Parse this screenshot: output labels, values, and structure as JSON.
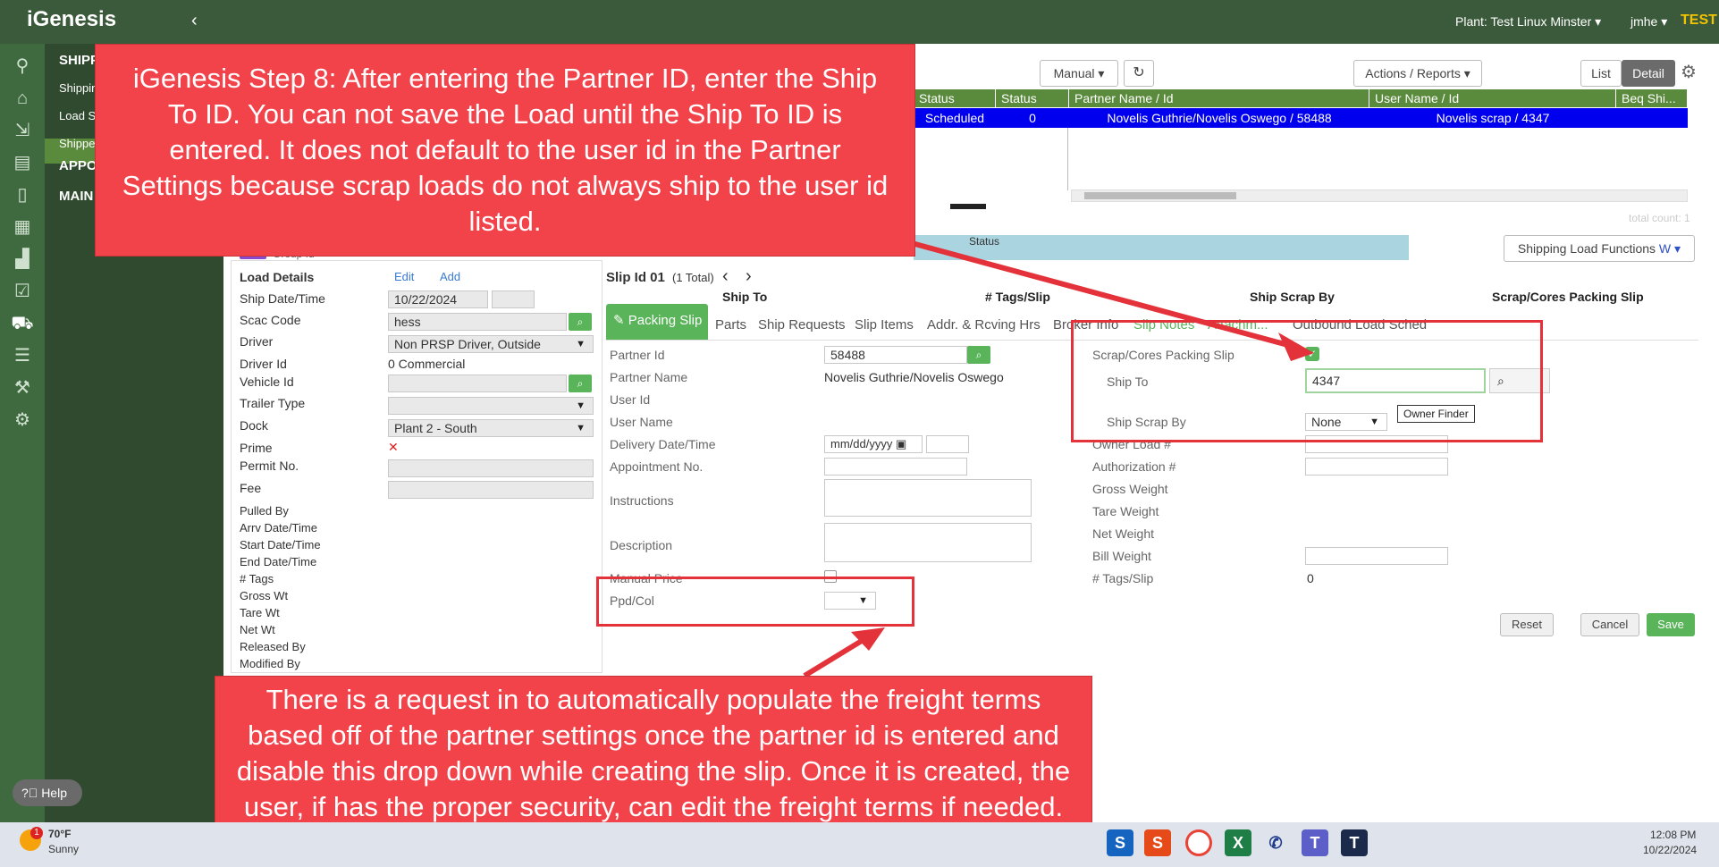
{
  "topbar": {
    "logo": "iGenesis",
    "plant": "Plant: Test Linux Minster",
    "user": "jmhe",
    "env": "TEST"
  },
  "sidebar": {
    "shipping_section": "SHIPP",
    "item1": "Shippin",
    "item2": "Load S",
    "item3": "Shippe",
    "appo_section": "APPO",
    "main_section": "MAIN",
    "help": "Help"
  },
  "toolbar": {
    "mode": "Manual",
    "actions": "Actions / Reports",
    "list": "List",
    "detail": "Detail"
  },
  "grid": {
    "headers": [
      "Status",
      "Status Code",
      "Partner Name / Id",
      "User Name / Id",
      "Beq Shi..."
    ],
    "row": {
      "status": "Scheduled",
      "status_code": "0",
      "partner": "Novelis Guthrie/Novelis Oswego / 58488",
      "user": "Novelis scrap / 4347"
    },
    "total_count": "total count: 1",
    "status_bar_label": "Status"
  },
  "shipping_functions": "Shipping Load Functions",
  "load_details": {
    "title": "Load Details",
    "edit": "Edit",
    "add": "Add",
    "group_label": "Group Id",
    "fields": {
      "ship_date": "Ship Date/Time",
      "ship_date_value": "10/22/2024",
      "scac": "Scac Code",
      "scac_value": "hess",
      "driver": "Driver",
      "driver_value": "Non PRSP Driver, Outside",
      "driver_id": "Driver Id",
      "driver_id_value": "0 Commercial",
      "vehicle_id": "Vehicle Id",
      "trailer_type": "Trailer Type",
      "dock": "Dock",
      "dock_value": "Plant 2 - South",
      "prime": "Prime",
      "permit": "Permit No.",
      "fee": "Fee",
      "pulled_by": "Pulled By",
      "arrv": "Arrv Date/Time",
      "start": "Start Date/Time",
      "end": "End Date/Time",
      "tags": "# Tags",
      "gross": "Gross Wt",
      "tare": "Tare Wt",
      "net": "Net Wt",
      "released": "Released By",
      "modified": "Modified By"
    }
  },
  "slip": {
    "title": "Slip Id 01",
    "total": "(1 Total)",
    "col_ship_to": "Ship To",
    "col_tags": "# Tags/Slip",
    "col_scrap_by": "Ship Scrap By",
    "col_packing": "Scrap/Cores Packing Slip",
    "tabs": [
      "Packing Slip",
      "Parts",
      "Ship Requests",
      "Slip Items",
      "Addr. & Rcving Hrs",
      "Broker Info",
      "Slip Notes",
      "Attachm...",
      "Outbound Load Sched"
    ],
    "left": {
      "partner_id": "Partner Id",
      "partner_id_value": "58488",
      "partner_name": "Partner Name",
      "partner_name_value": "Novelis Guthrie/Novelis Oswego",
      "user_id": "User Id",
      "user_name": "User Name",
      "delivery": "Delivery Date/Time",
      "delivery_placeholder": "mm/dd/yyyy",
      "appointment": "Appointment No.",
      "instructions": "Instructions",
      "description": "Description",
      "manual_price": "Manual Price",
      "ppd": "Ppd/Col"
    },
    "right": {
      "packing": "Scrap/Cores Packing Slip",
      "ship_to": "Ship To",
      "ship_to_value": "4347",
      "scrap_by": "Ship Scrap By",
      "scrap_by_value": "None",
      "owner_finder": "Owner Finder",
      "owner_load": "Owner Load #",
      "auth": "Authorization #",
      "gross": "Gross Weight",
      "tare": "Tare Weight",
      "net": "Net Weight",
      "bill": "Bill Weight",
      "tags": "# Tags/Slip",
      "tags_value": "0"
    },
    "buttons": {
      "reset": "Reset",
      "cancel": "Cancel",
      "save": "Save"
    }
  },
  "annotations": {
    "top": "iGenesis Step 8: After entering the Partner ID, enter the Ship To ID. You can not save the Load until the Ship To ID is entered. It does not default to the user id in the Partner Settings because scrap loads do not always ship to the user id listed.",
    "bottom": "There is a request in to automatically populate the freight terms based off of the partner settings once the partner id is entered and disable this drop down while creating the slip. Once it is created, the user, if has the proper security, can edit the freight terms if needed."
  },
  "taskbar": {
    "weather_temp": "70°F",
    "weather_desc": "Sunny",
    "weather_badge": "1",
    "time": "12:08 PM",
    "date": "10/22/2024"
  }
}
